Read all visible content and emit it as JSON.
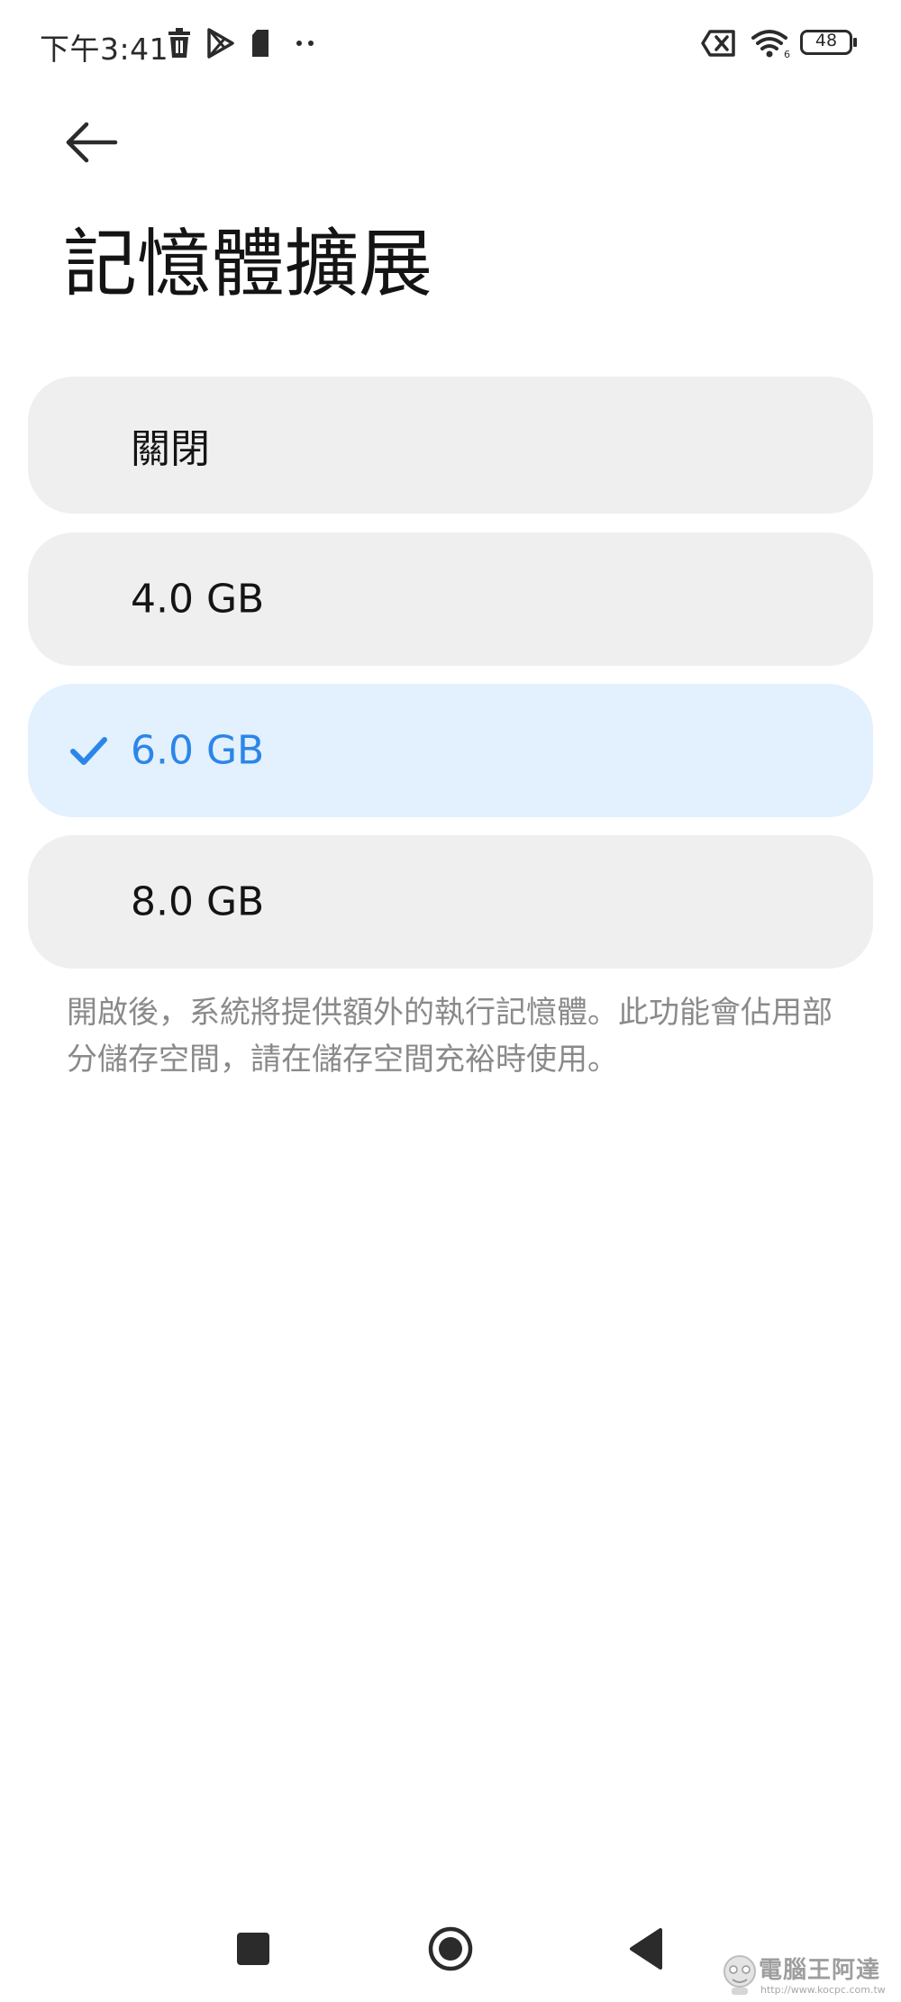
{
  "status_bar": {
    "time": "下午3:41",
    "battery_level": "48",
    "icons": [
      "trash-icon",
      "play-store-icon",
      "sim-card-icon",
      "more-dots-icon",
      "screen-record-icon",
      "wifi-6-icon",
      "battery-icon"
    ]
  },
  "header": {
    "back_icon": "arrow-left-icon",
    "title": "記憶體擴展"
  },
  "options": [
    {
      "label": "關閉",
      "selected": false
    },
    {
      "label": "4.0 GB",
      "selected": false
    },
    {
      "label": "6.0 GB",
      "selected": true
    },
    {
      "label": "8.0 GB",
      "selected": false
    }
  ],
  "description": "開啟後，系統將提供額外的執行記憶體。此功能會佔用部分儲存空間，請在儲存空間充裕時使用。",
  "nav_bar": {
    "icons": [
      "recents-square-icon",
      "home-circle-icon",
      "back-triangle-icon"
    ]
  },
  "watermark": {
    "text": "電腦王阿達",
    "url": "http://www.kocpc.com.tw"
  },
  "colors": {
    "accent": "#2b86e8",
    "option_bg": "#efefef",
    "selected_bg": "#e3f0fd",
    "description_text": "#8a8a8a"
  }
}
